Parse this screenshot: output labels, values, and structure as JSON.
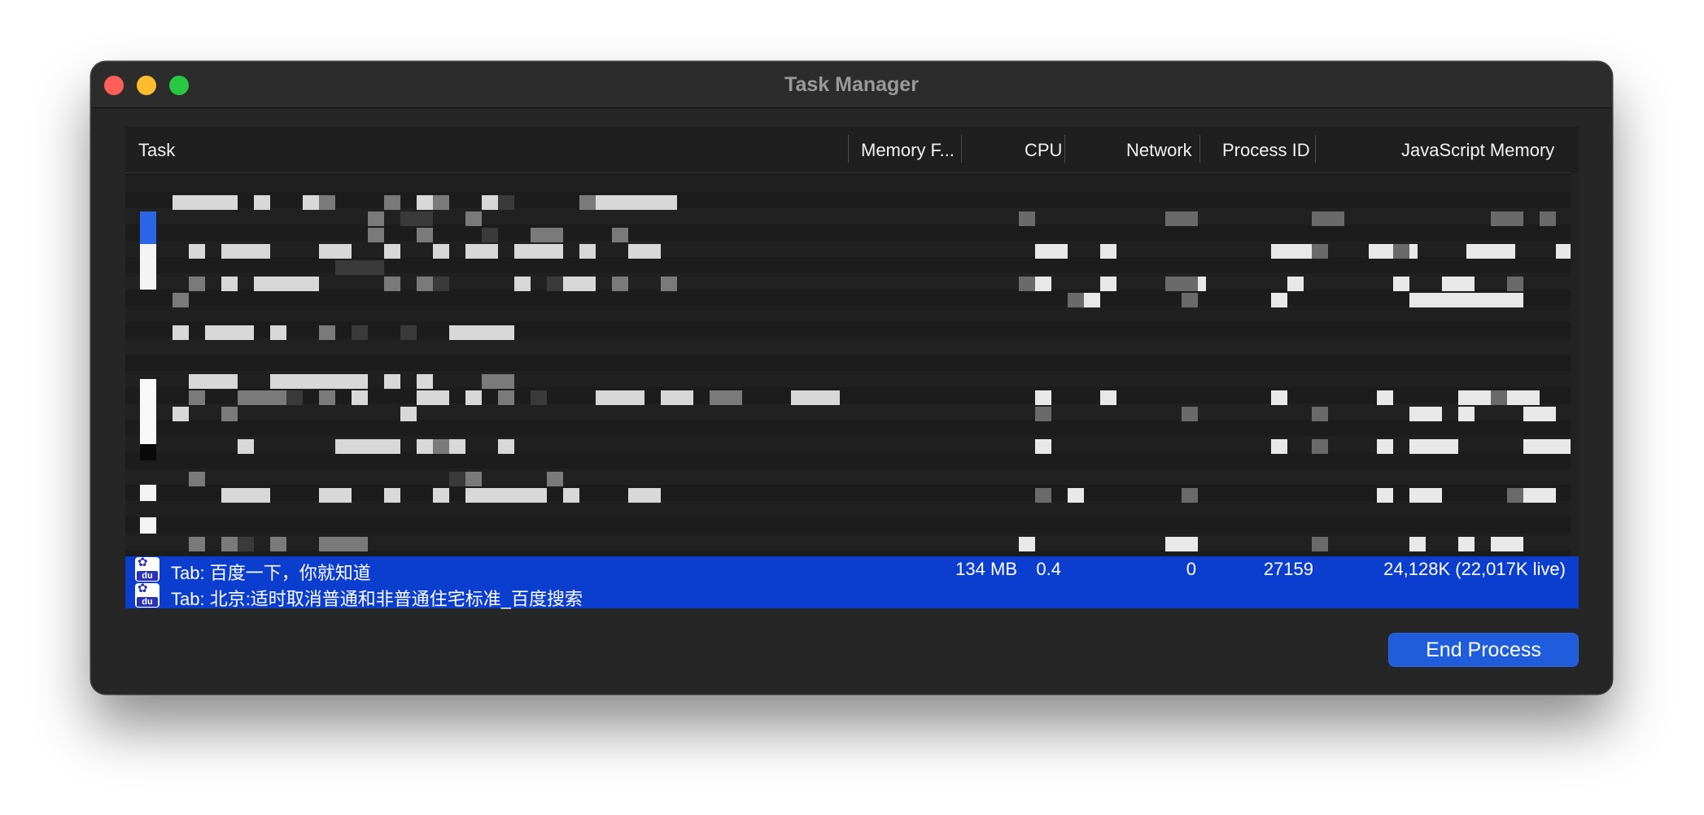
{
  "window": {
    "title": "Task Manager"
  },
  "columns": {
    "task": "Task",
    "memory": "Memory F...",
    "cpu": "CPU",
    "network": "Network",
    "pid": "Process ID",
    "js_memory": "JavaScript Memory"
  },
  "selected": {
    "rows": [
      {
        "icon": "baidu-icon",
        "task": "Tab: 百度一下，你就知道"
      },
      {
        "icon": "baidu-icon",
        "task": "Tab: 北京:适时取消普通和非普通住宅标准_百度搜索"
      }
    ],
    "memory": "134 MB",
    "cpu": "0.4",
    "network": "0",
    "pid": "27159",
    "js_memory": "24,128K (22,017K live)"
  },
  "actions": {
    "end_process": "End Process"
  },
  "colors": {
    "selection": "#0b3dcf",
    "button": "#1f5ddc",
    "window_bg": "#262626"
  }
}
